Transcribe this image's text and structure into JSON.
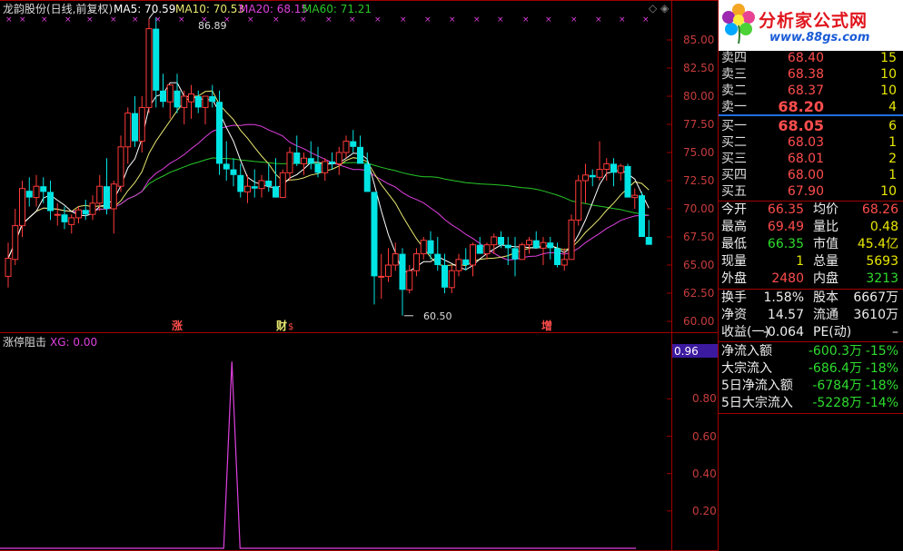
{
  "header": {
    "title": "龙韵股份(日线,前复权)",
    "ma5": "MA5: 70.59",
    "ma10": "MA10: 70.53",
    "ma20": "MA20: 68.15",
    "ma60": "MA60: 71.21"
  },
  "colors": {
    "up": "#ff3a3a",
    "down": "#00e4e4",
    "ma5": "#ffffff",
    "ma10": "#e8e870",
    "ma20": "#e040e0",
    "ma60": "#28c828",
    "axis": "#a00000"
  },
  "price_axis": {
    "labels": [
      "85.00",
      "82.50",
      "80.00",
      "77.50",
      "75.00",
      "72.50",
      "70.00",
      "67.50",
      "65.00",
      "62.50",
      "60.00"
    ],
    "max_label": "86.89",
    "min_label": "60.50"
  },
  "event_marks": [
    "涨",
    "财",
    "$",
    "增"
  ],
  "indicator": {
    "title": "涨停阻击",
    "xg_label": "XG: 0.00",
    "current_value": "0.96",
    "labels": [
      "0.80",
      "0.60",
      "0.40",
      "0.20"
    ]
  },
  "chart_data": {
    "type": "candlestick",
    "ylim": [
      59.5,
      87.5
    ],
    "candles": [
      [
        64.0,
        67.0,
        63.0,
        65.6
      ],
      [
        65.5,
        70.0,
        65.0,
        68.5
      ],
      [
        68.5,
        72.5,
        67.5,
        71.8
      ],
      [
        71.6,
        72.8,
        70.2,
        71.0
      ],
      [
        71.0,
        73.0,
        70.2,
        72.0
      ],
      [
        72.0,
        72.8,
        70.5,
        71.5
      ],
      [
        71.5,
        72.5,
        69.0,
        69.8
      ],
      [
        69.5,
        70.5,
        68.5,
        69.5
      ],
      [
        69.5,
        70.2,
        68.2,
        68.8
      ],
      [
        68.6,
        69.5,
        67.8,
        69.2
      ],
      [
        69.2,
        70.2,
        68.7,
        69.9
      ],
      [
        69.9,
        70.8,
        69.0,
        69.5
      ],
      [
        69.5,
        71.2,
        69.0,
        70.5
      ],
      [
        70.5,
        73.0,
        69.8,
        72.0
      ],
      [
        72.0,
        74.5,
        69.5,
        70.0
      ],
      [
        70.0,
        72.5,
        67.8,
        72.2
      ],
      [
        72.0,
        76.5,
        71.5,
        75.5
      ],
      [
        75.5,
        79.0,
        74.0,
        78.5
      ],
      [
        78.5,
        80.0,
        75.5,
        76.0
      ],
      [
        76.0,
        80.0,
        75.0,
        79.0
      ],
      [
        79.0,
        86.9,
        78.5,
        86.0
      ],
      [
        86.0,
        87.0,
        79.0,
        80.5
      ],
      [
        80.5,
        82.0,
        79.0,
        79.5
      ],
      [
        79.5,
        80.5,
        78.0,
        81.0
      ],
      [
        80.5,
        82.0,
        78.5,
        79.0
      ],
      [
        79.0,
        80.5,
        77.5,
        80.0
      ],
      [
        79.5,
        81.0,
        78.0,
        80.2
      ],
      [
        80.0,
        80.5,
        78.5,
        79.0
      ],
      [
        79.0,
        80.0,
        77.5,
        80.0
      ],
      [
        80.0,
        81.0,
        79.0,
        79.5
      ],
      [
        79.5,
        80.5,
        73.0,
        74.0
      ],
      [
        74.0,
        76.0,
        72.5,
        73.5
      ],
      [
        73.5,
        74.5,
        72.0,
        73.0
      ],
      [
        73.0,
        74.0,
        71.0,
        71.5
      ],
      [
        71.5,
        73.0,
        70.5,
        72.0
      ],
      [
        72.0,
        73.5,
        71.0,
        71.8
      ],
      [
        71.8,
        73.0,
        71.0,
        72.5
      ],
      [
        72.5,
        74.0,
        71.5,
        72.0
      ],
      [
        72.0,
        74.5,
        71.0,
        71.0
      ],
      [
        71.0,
        73.5,
        71.0,
        73.2
      ],
      [
        73.2,
        75.5,
        72.5,
        75.0
      ],
      [
        75.0,
        76.5,
        73.8,
        74.0
      ],
      [
        74.0,
        75.0,
        73.0,
        74.5
      ],
      [
        74.5,
        76.0,
        73.5,
        74.0
      ],
      [
        74.0,
        75.5,
        72.8,
        73.2
      ],
      [
        73.2,
        74.5,
        72.5,
        74.2
      ],
      [
        74.2,
        75.0,
        73.5,
        74.0
      ],
      [
        74.0,
        75.5,
        73.0,
        75.0
      ],
      [
        75.0,
        76.5,
        74.5,
        76.0
      ],
      [
        76.0,
        77.0,
        75.0,
        75.5
      ],
      [
        75.5,
        76.5,
        74.5,
        74.0
      ],
      [
        74.0,
        75.0,
        71.5,
        71.5
      ],
      [
        71.5,
        71.5,
        61.5,
        64.0
      ],
      [
        64.0,
        66.0,
        62.0,
        64.0
      ],
      [
        64.0,
        66.5,
        63.5,
        65.0
      ],
      [
        65.0,
        67.0,
        64.5,
        66.0
      ],
      [
        66.0,
        66.5,
        60.5,
        62.8
      ],
      [
        62.8,
        65.0,
        62.5,
        64.5
      ],
      [
        64.5,
        66.5,
        64.0,
        66.0
      ],
      [
        66.0,
        67.5,
        65.5,
        67.2
      ],
      [
        67.2,
        68.0,
        65.5,
        66.0
      ],
      [
        66.0,
        67.5,
        64.5,
        65.0
      ],
      [
        65.0,
        66.0,
        62.5,
        63.0
      ],
      [
        63.0,
        65.0,
        62.5,
        64.5
      ],
      [
        64.5,
        66.0,
        64.0,
        65.5
      ],
      [
        65.5,
        66.5,
        64.5,
        65.0
      ],
      [
        65.0,
        67.0,
        64.0,
        66.8
      ],
      [
        66.8,
        67.5,
        66.0,
        66.0
      ],
      [
        66.0,
        67.0,
        65.5,
        66.8
      ],
      [
        66.8,
        67.8,
        66.0,
        67.5
      ],
      [
        67.5,
        68.0,
        66.5,
        66.8
      ],
      [
        66.8,
        67.5,
        65.0,
        66.5
      ],
      [
        66.5,
        67.5,
        64.0,
        65.5
      ],
      [
        65.5,
        67.0,
        65.5,
        66.8
      ],
      [
        66.8,
        67.5,
        66.0,
        67.2
      ],
      [
        67.2,
        68.0,
        66.5,
        66.5
      ],
      [
        66.5,
        67.5,
        65.0,
        67.0
      ],
      [
        67.0,
        67.5,
        65.5,
        66.5
      ],
      [
        66.5,
        67.0,
        64.8,
        65.0
      ],
      [
        65.0,
        66.5,
        64.5,
        65.5
      ],
      [
        65.5,
        69.5,
        65.5,
        69.0
      ],
      [
        69.0,
        73.0,
        68.5,
        72.5
      ],
      [
        72.5,
        74.0,
        70.5,
        73.0
      ],
      [
        73.0,
        73.5,
        72.0,
        72.8
      ],
      [
        72.8,
        76.0,
        72.5,
        73.5
      ],
      [
        73.5,
        74.5,
        72.5,
        74.0
      ],
      [
        74.0,
        74.5,
        72.0,
        73.2
      ],
      [
        73.2,
        74.0,
        72.5,
        73.8
      ],
      [
        73.8,
        74.0,
        72.0,
        71.0
      ],
      [
        71.0,
        71.8,
        70.0,
        71.2
      ],
      [
        71.2,
        71.5,
        67.5,
        67.5
      ],
      [
        67.5,
        69.0,
        66.8,
        66.8
      ]
    ],
    "indicator_peak": {
      "index": 31,
      "value": 1.0
    },
    "indicator_ylim": [
      0,
      1.05
    ]
  },
  "quotes": {
    "logo_title": "分析家公式网",
    "logo_url": "www.88gs.com",
    "sell": [
      {
        "label": "卖四",
        "price": "68.40",
        "vol": "15"
      },
      {
        "label": "卖三",
        "price": "68.38",
        "vol": "10"
      },
      {
        "label": "卖二",
        "price": "68.37",
        "vol": "10"
      },
      {
        "label": "卖一",
        "price": "68.20",
        "vol": "4"
      }
    ],
    "buy": [
      {
        "label": "买一",
        "price": "68.05",
        "vol": "6"
      },
      {
        "label": "买二",
        "price": "68.03",
        "vol": "1"
      },
      {
        "label": "买三",
        "price": "68.01",
        "vol": "2"
      },
      {
        "label": "买四",
        "price": "68.00",
        "vol": "1"
      },
      {
        "label": "买五",
        "price": "67.90",
        "vol": "10"
      }
    ],
    "stats": [
      {
        "l1": "今开",
        "v1": "66.35",
        "l2": "均价",
        "v2": "68.26"
      },
      {
        "l1": "最高",
        "v1": "69.49",
        "l2": "量比",
        "v2": "0.48"
      },
      {
        "l1": "最低",
        "v1": "66.35",
        "l2": "市值",
        "v2": "45.4亿"
      },
      {
        "l1": "现量",
        "v1": "1",
        "l2": "总量",
        "v2": "5693"
      },
      {
        "l1": "外盘",
        "v1": "2480",
        "l2": "内盘",
        "v2": "3213"
      }
    ],
    "finance": [
      {
        "l1": "换手",
        "v1": "1.58%",
        "l2": "股本",
        "v2": "6667万"
      },
      {
        "l1": "净资",
        "v1": "14.57",
        "l2": "流通",
        "v2": "3610万"
      },
      {
        "l1": "收益(一)",
        "v1": "-0.064",
        "l2": "PE(动)",
        "v2": "–"
      }
    ],
    "flows": [
      {
        "label": "净流入额",
        "value": "-600.3万",
        "pct": "-15%"
      },
      {
        "label": "大宗流入",
        "value": "-686.4万",
        "pct": "-18%"
      },
      {
        "label": "5日净流入额",
        "value": "-6784万",
        "pct": "-18%"
      },
      {
        "label": "5日大宗流入",
        "value": "-5228万",
        "pct": "-14%"
      }
    ]
  }
}
